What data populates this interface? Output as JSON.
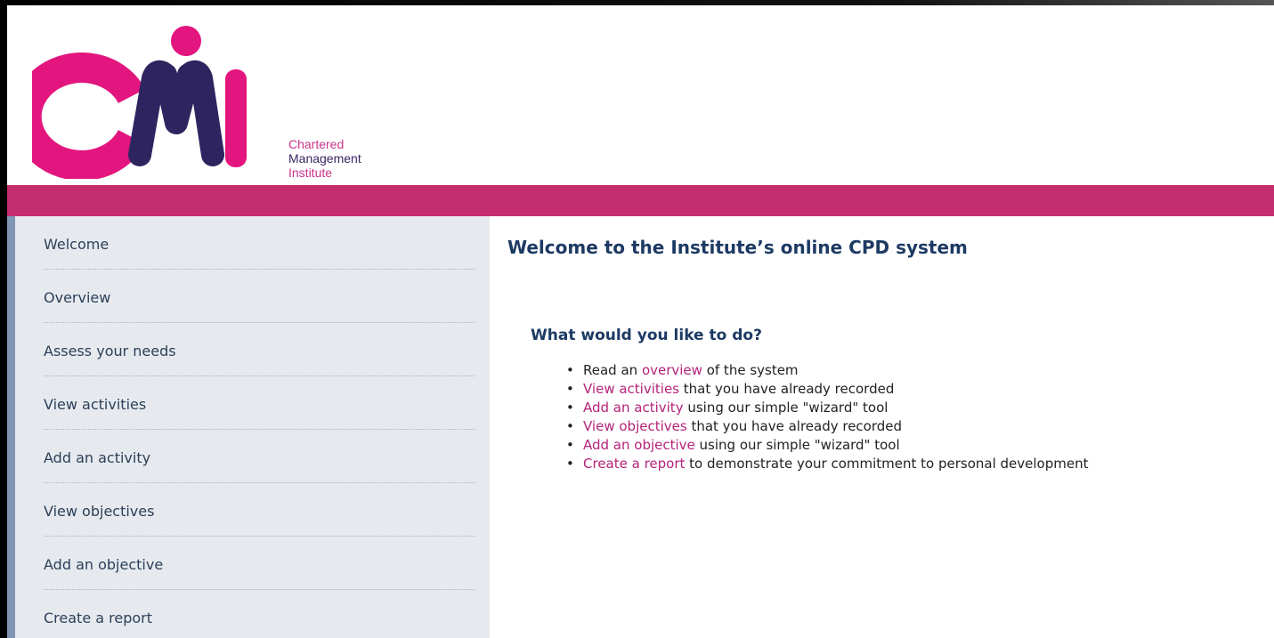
{
  "brand": {
    "logo_letters": "CMI",
    "name_line_1": "Chartered",
    "name_line_2": "Management",
    "name_line_3": "Institute",
    "colors": {
      "pink": "#e3157e",
      "navy": "#2e2560",
      "band": "#c52e6e",
      "link": "#b4237a",
      "heading": "#1d3a63"
    }
  },
  "sidebar": {
    "items": [
      {
        "label": "Welcome"
      },
      {
        "label": "Overview"
      },
      {
        "label": "Assess your needs"
      },
      {
        "label": "View activities"
      },
      {
        "label": "Add an activity"
      },
      {
        "label": "View objectives"
      },
      {
        "label": "Add an objective"
      },
      {
        "label": "Create a report"
      }
    ]
  },
  "main": {
    "title": "Welcome to the Institute’s online CPD system",
    "subtitle": "What would you like to do?",
    "actions": [
      {
        "before": "Read an ",
        "link": "overview",
        "after": " of the system"
      },
      {
        "before": "",
        "link": "View activities",
        "after": " that you have already recorded"
      },
      {
        "before": "",
        "link": "Add an activity",
        "after": " using our simple \"wizard\" tool"
      },
      {
        "before": "",
        "link": "View objectives",
        "after": " that you have already recorded"
      },
      {
        "before": "",
        "link": "Add an objective",
        "after": " using our simple \"wizard\" tool"
      },
      {
        "before": "",
        "link": "Create a report",
        "after": " to demonstrate your commitment to personal development"
      }
    ]
  }
}
